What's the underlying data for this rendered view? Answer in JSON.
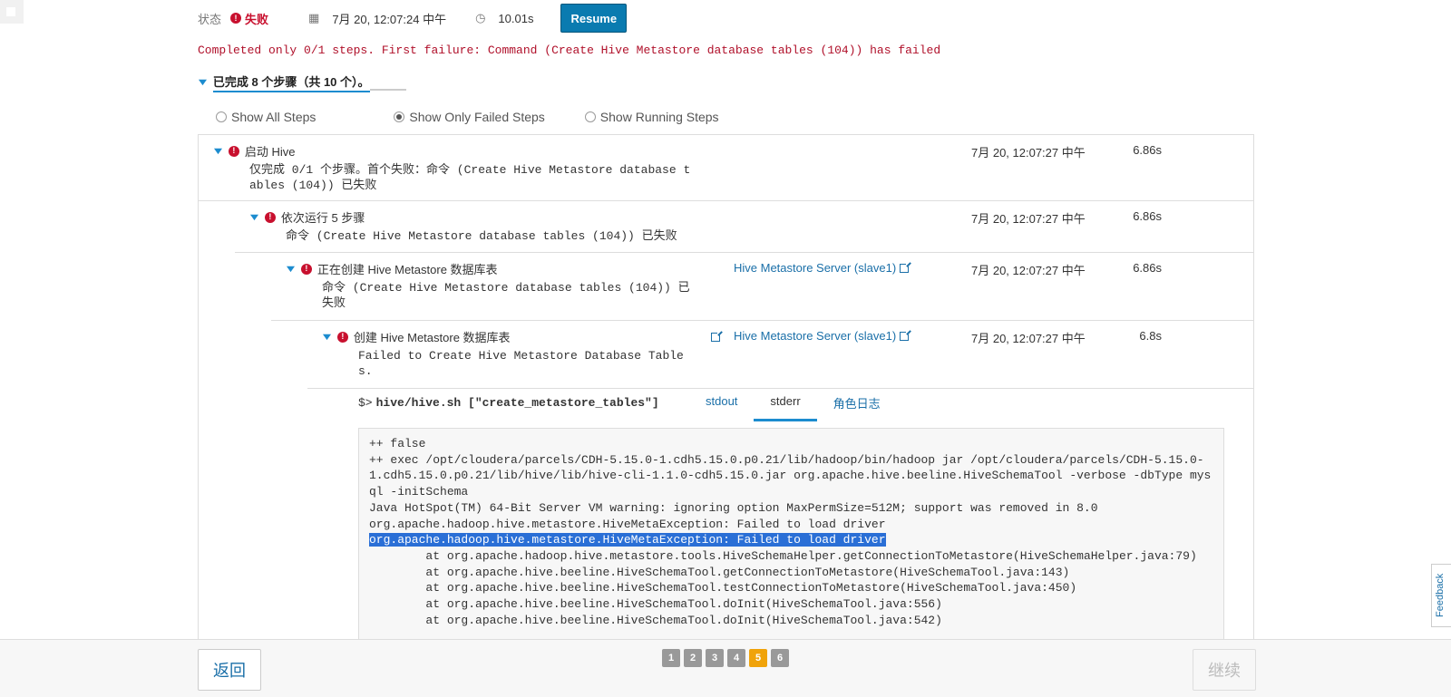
{
  "header": {
    "status_label": "状态",
    "status_value": "失败",
    "date": "7月 20, 12:07:24 中午",
    "duration": "10.01s",
    "resume_label": "Resume",
    "calendar_icon": "calendar-icon",
    "clock_icon": "clock-icon"
  },
  "error_message": "Completed only 0/1 steps. First failure: Command (Create Hive Metastore database tables (104)) has failed",
  "steps_summary": "已完成 8 个步骤（共 10 个）。",
  "filters": [
    {
      "label": "Show All Steps",
      "selected": false
    },
    {
      "label": "Show Only Failed Steps",
      "selected": true
    },
    {
      "label": "Show Running Steps",
      "selected": false
    }
  ],
  "steps": [
    {
      "title": "启动 Hive",
      "message": "仅完成 0/1 个步骤。首个失败：命令 (Create Hive Metastore database tables (104)) 已失败",
      "link": "",
      "time": "7月 20, 12:07:27 中午",
      "duration": "6.86s"
    },
    {
      "title": "依次运行 5 步骤",
      "message": "命令 (Create Hive Metastore database tables (104)) 已失败",
      "link": "",
      "time": "7月 20, 12:07:27 中午",
      "duration": "6.86s"
    },
    {
      "title": "正在创建 Hive Metastore 数据库表",
      "message": "命令 (Create Hive Metastore database tables (104)) 已失败",
      "link": "Hive Metastore Server (slave1)",
      "time": "7月 20, 12:07:27 中午",
      "duration": "6.86s"
    },
    {
      "title": "创建 Hive Metastore 数据库表",
      "message": "Failed to Create Hive Metastore Database Tables.",
      "link": "Hive Metastore Server (slave1)",
      "time": "7月 20, 12:07:27 中午",
      "duration": "6.8s"
    }
  ],
  "command": {
    "prompt": "$>",
    "text": "hive/hive.sh [\"create_metastore_tables\"]",
    "tabs": [
      "stdout",
      "stderr",
      "角色日志"
    ],
    "active_tab": "stderr"
  },
  "log": {
    "before": "++ false\n++ exec /opt/cloudera/parcels/CDH-5.15.0-1.cdh5.15.0.p0.21/lib/hadoop/bin/hadoop jar /opt/cloudera/parcels/CDH-5.15.0-1.cdh5.15.0.p0.21/lib/hive/lib/hive-cli-1.1.0-cdh5.15.0.jar org.apache.hive.beeline.HiveSchemaTool -verbose -dbType mysql -initSchema\nJava HotSpot(TM) 64-Bit Server VM warning: ignoring option MaxPermSize=512M; support was removed in 8.0\norg.apache.hadoop.hive.metastore.HiveMetaException: Failed to load driver\n",
    "highlight": "org.apache.hadoop.hive.metastore.HiveMetaException: Failed to load driver",
    "after": "\n\tat org.apache.hadoop.hive.metastore.tools.HiveSchemaHelper.getConnectionToMetastore(HiveSchemaHelper.java:79)\n\tat org.apache.hive.beeline.HiveSchemaTool.getConnectionToMetastore(HiveSchemaTool.java:143)\n\tat org.apache.hive.beeline.HiveSchemaTool.testConnectionToMetastore(HiveSchemaTool.java:450)\n\tat org.apache.hive.beeline.HiveSchemaTool.doInit(HiveSchemaTool.java:556)\n\tat org.apache.hive.beeline.HiveSchemaTool.doInit(HiveSchemaTool.java:542)"
  },
  "footer": {
    "back_label": "返回",
    "next_label": "继续",
    "pages": [
      "1",
      "2",
      "3",
      "4",
      "5",
      "6"
    ],
    "active_page": "5"
  },
  "feedback_label": "Feedback",
  "colors": {
    "accent": "#1c8ccf",
    "error": "#c8102e",
    "resume": "#0a7bb0",
    "active_page": "#f0a30a"
  }
}
